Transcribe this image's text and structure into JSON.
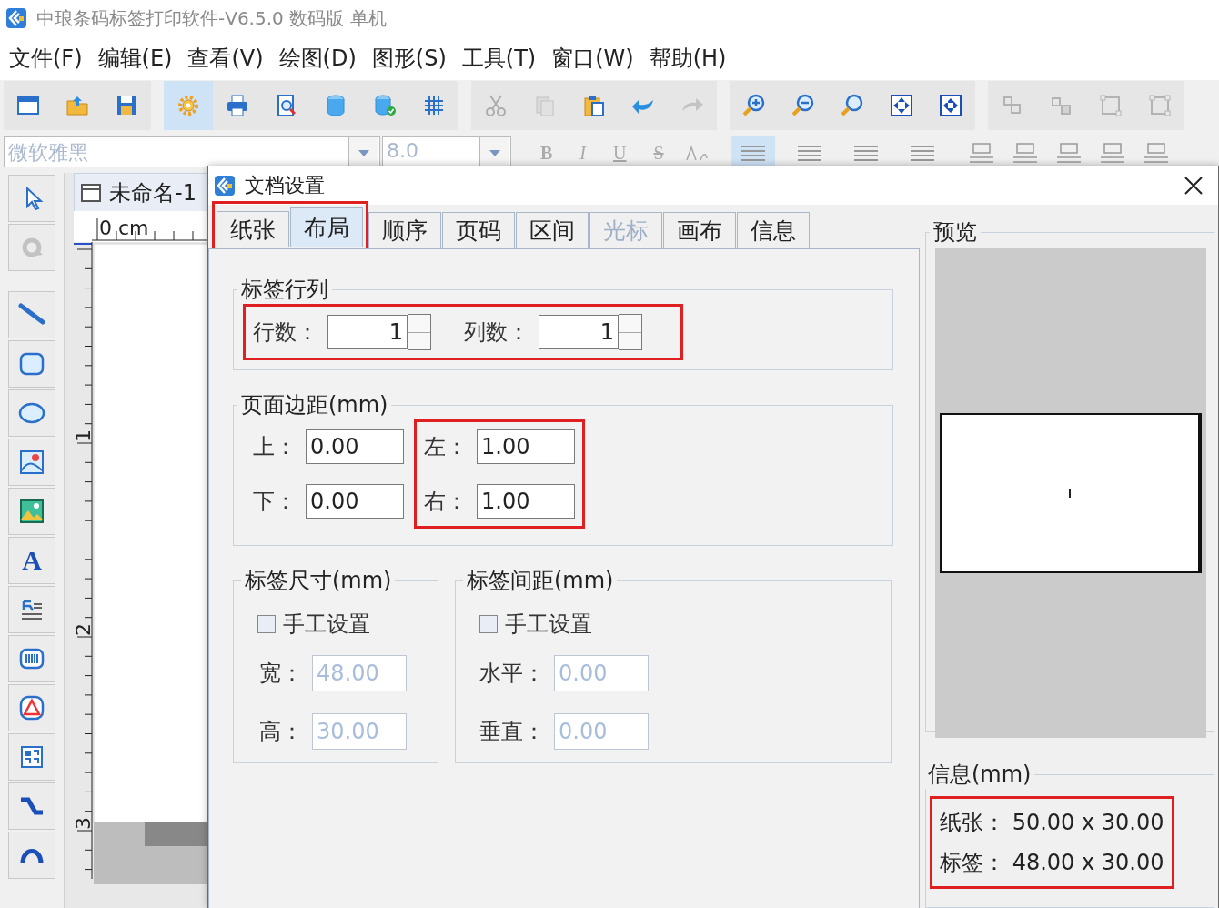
{
  "window": {
    "title": "中琅条码标签打印软件-V6.5.0 数码版 单机"
  },
  "menu": [
    "文件(F)",
    "编辑(E)",
    "查看(V)",
    "绘图(D)",
    "图形(S)",
    "工具(T)",
    "窗口(W)",
    "帮助(H)"
  ],
  "toolbar": {
    "groups": [
      [
        {
          "selected": false,
          "disabled": false
        },
        {
          "selected": false,
          "disabled": false
        },
        {
          "selected": false,
          "disabled": false
        }
      ],
      [
        {
          "selected": true,
          "disabled": false
        },
        {
          "selected": false,
          "disabled": false
        },
        {
          "selected": false,
          "disabled": false
        },
        {
          "selected": false,
          "disabled": false
        },
        {
          "selected": false,
          "disabled": false
        },
        {
          "selected": false,
          "disabled": false
        }
      ],
      [
        {
          "selected": false,
          "disabled": true
        },
        {
          "selected": false,
          "disabled": true
        },
        {
          "selected": false,
          "disabled": false
        },
        {
          "selected": false,
          "disabled": false
        },
        {
          "selected": false,
          "disabled": true
        }
      ],
      [
        {
          "selected": false,
          "disabled": false
        },
        {
          "selected": false,
          "disabled": false
        },
        {
          "selected": false,
          "disabled": false
        },
        {
          "selected": false,
          "disabled": false
        },
        {
          "selected": false,
          "disabled": false
        }
      ],
      [
        {
          "selected": false,
          "disabled": true
        },
        {
          "selected": false,
          "disabled": true
        },
        {
          "selected": false,
          "disabled": true
        },
        {
          "selected": false,
          "disabled": true
        }
      ]
    ]
  },
  "format_bar": {
    "font": {
      "value": "微软雅黑",
      "disabled": true
    },
    "size": {
      "value": "8.0",
      "disabled": true
    },
    "style_buttons": [
      {
        "label": "B",
        "disabled": true
      },
      {
        "label": "I",
        "disabled": true
      },
      {
        "label": "U",
        "disabled": true
      },
      {
        "label": "S",
        "disabled": true
      }
    ],
    "align_buttons": [
      {
        "selected": true
      },
      {
        "selected": false
      },
      {
        "selected": false
      },
      {
        "selected": false
      }
    ]
  },
  "tools": [
    {
      "disabled": false
    },
    {
      "disabled": true
    },
    {
      "disabled": false
    },
    {
      "disabled": false
    },
    {
      "disabled": false
    },
    {
      "disabled": false
    },
    {
      "disabled": false
    },
    {
      "disabled": false,
      "glyph": "A"
    },
    {
      "disabled": false
    },
    {
      "disabled": false
    },
    {
      "disabled": false
    },
    {
      "disabled": false
    },
    {
      "disabled": false
    },
    {
      "disabled": false
    }
  ],
  "document": {
    "tab": "未命名-1",
    "ruler_unit": "0 cm",
    "ruler_marks": [
      "1",
      "2",
      "3"
    ]
  },
  "dialog": {
    "title": "文档设置",
    "tabs": [
      {
        "label": "纸张",
        "selected": false,
        "disabled": false,
        "highlighted": true
      },
      {
        "label": "布局",
        "selected": true,
        "disabled": false,
        "highlighted": true
      },
      {
        "label": "顺序",
        "selected": false,
        "disabled": false,
        "highlighted": false
      },
      {
        "label": "页码",
        "selected": false,
        "disabled": false,
        "highlighted": false
      },
      {
        "label": "区间",
        "selected": false,
        "disabled": false,
        "highlighted": false
      },
      {
        "label": "光标",
        "selected": false,
        "disabled": true,
        "highlighted": false
      },
      {
        "label": "画布",
        "selected": false,
        "disabled": false,
        "highlighted": false
      },
      {
        "label": "信息",
        "selected": false,
        "disabled": false,
        "highlighted": false
      }
    ],
    "rows_cols": {
      "title": "标签行列",
      "highlighted": true,
      "fields": [
        {
          "label": "行数：",
          "value": "1"
        },
        {
          "label": "列数：",
          "value": "1"
        }
      ]
    },
    "margins": {
      "title": "页面边距(mm)",
      "columns": [
        {
          "highlighted": false,
          "fields": [
            {
              "label": "上：",
              "value": "0.00"
            },
            {
              "label": "下：",
              "value": "0.00"
            }
          ]
        },
        {
          "highlighted": true,
          "fields": [
            {
              "label": "左：",
              "value": "1.00"
            },
            {
              "label": "右：",
              "value": "1.00"
            }
          ]
        }
      ]
    },
    "label_size": {
      "title": "标签尺寸(mm)",
      "manual": {
        "label": "手工设置",
        "checked": false
      },
      "fields": [
        {
          "label": "宽：",
          "value": "48.00",
          "disabled": true
        },
        {
          "label": "高：",
          "value": "30.00",
          "disabled": true
        }
      ]
    },
    "label_gap": {
      "title": "标签间距(mm)",
      "manual": {
        "label": "手工设置",
        "checked": false
      },
      "fields": [
        {
          "label": "水平：",
          "value": "0.00",
          "disabled": true
        },
        {
          "label": "垂直：",
          "value": "0.00",
          "disabled": true
        }
      ]
    },
    "preview": {
      "title": "预览"
    },
    "info": {
      "title": "信息(mm)",
      "highlighted": true,
      "lines": [
        {
          "label": "纸张：",
          "value": "50.00 x 30.00"
        },
        {
          "label": "标签：",
          "value": "48.00 x 30.00"
        }
      ]
    }
  }
}
